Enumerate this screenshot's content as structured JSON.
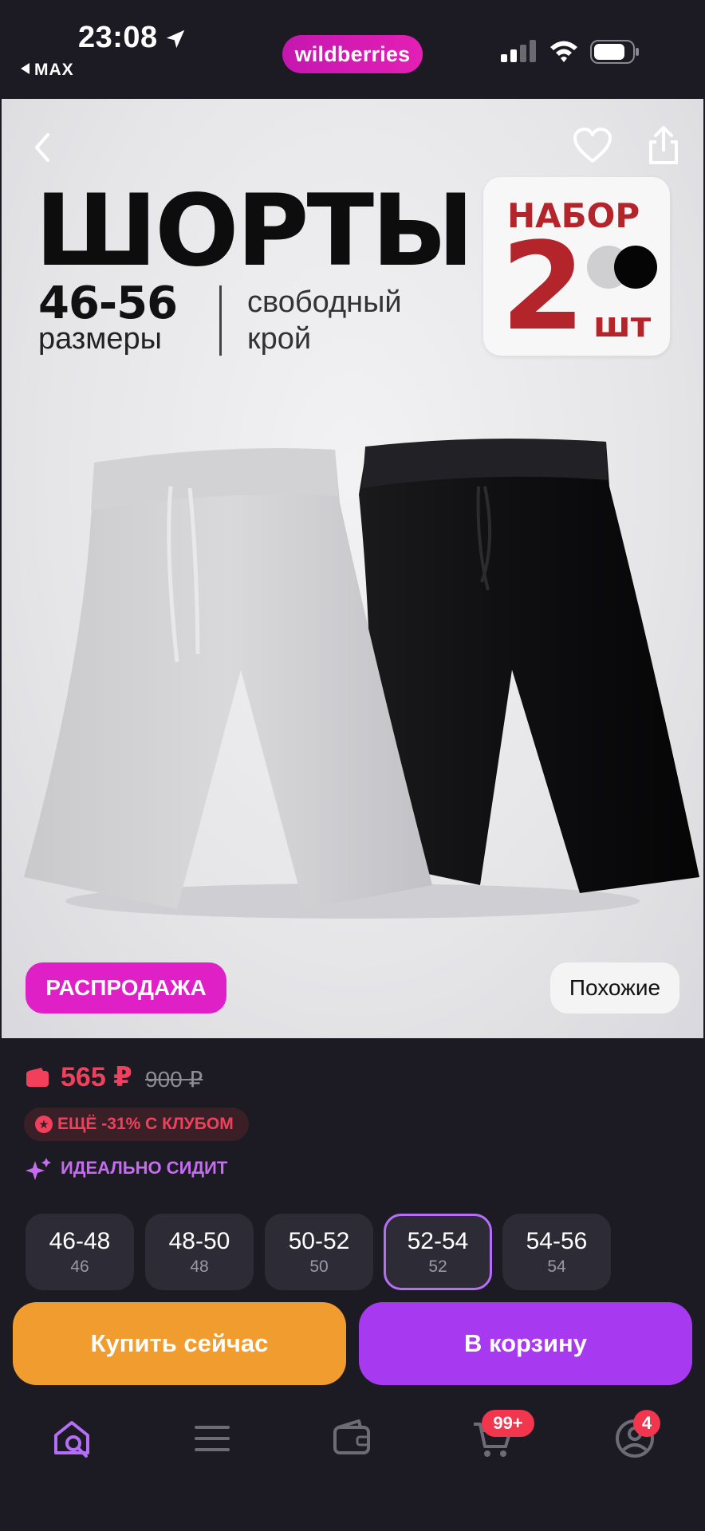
{
  "status_bar": {
    "time": "23:08",
    "back_app": "MAX",
    "app_badge": "wildberries"
  },
  "hero": {
    "title": "ШОРТЫ",
    "sizes_range": "46-56",
    "sizes_word": "размеры",
    "fit_line1": "свободный",
    "fit_line2": "крой",
    "set_word": "НАБОР",
    "set_count": "2",
    "set_unit": "шт",
    "sale_badge": "РАСПРОДАЖА",
    "similar_badge": "Похожие"
  },
  "price": {
    "current": "565 ₽",
    "old": "900 ₽",
    "club_offer": "ЕЩЁ -31% С КЛУБОМ",
    "fit_note": "ИДЕАЛЬНО СИДИТ"
  },
  "sizes": [
    {
      "label": "46-48",
      "ru": "46"
    },
    {
      "label": "48-50",
      "ru": "48"
    },
    {
      "label": "50-52",
      "ru": "50"
    },
    {
      "label": "52-54",
      "ru": "52"
    },
    {
      "label": "54-56",
      "ru": "54"
    }
  ],
  "selected_size": "52-54",
  "actions": {
    "buy_now": "Купить сейчас",
    "add_to_cart": "В корзину"
  },
  "tab_bar": {
    "cart_badge": "99+",
    "profile_badge": "4",
    "icons": [
      "home-search-icon",
      "menu-icon",
      "wallet-icon",
      "cart-icon",
      "profile-icon"
    ]
  },
  "colors": {
    "brand": "#cb11ab",
    "price": "#f2405c",
    "buy_now": "#f19c2f",
    "to_cart": "#a73af0",
    "set_red": "#b3242b"
  }
}
